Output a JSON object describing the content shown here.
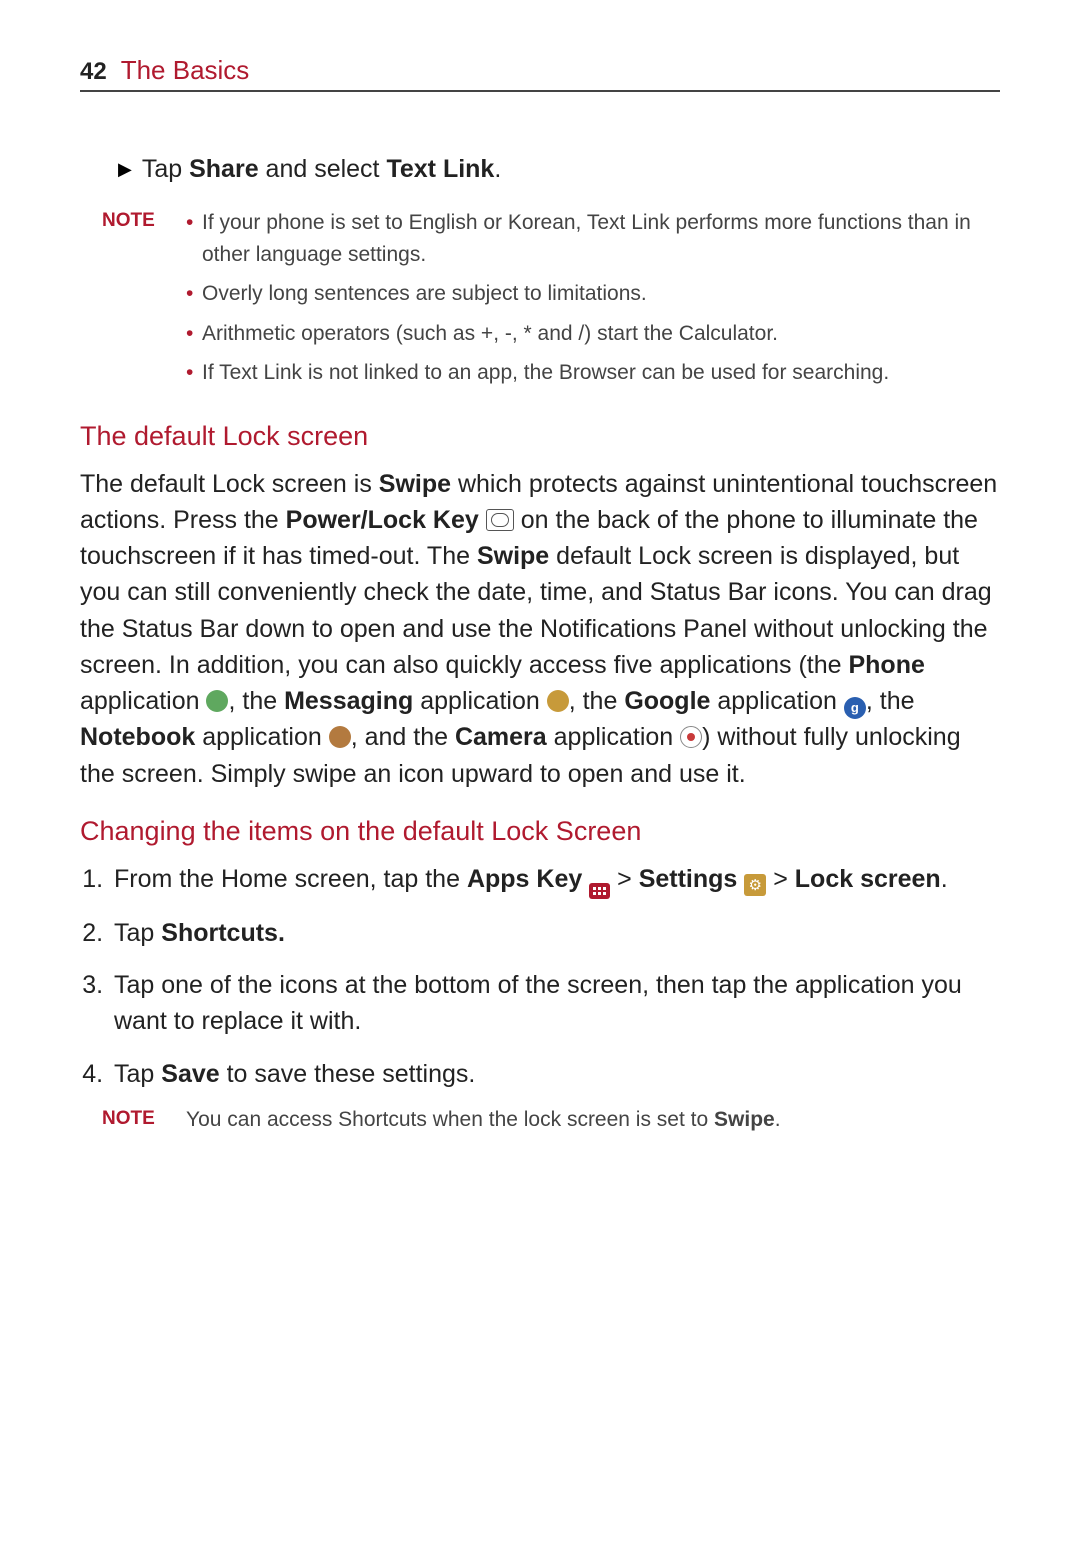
{
  "header": {
    "page_num": "42",
    "chapter": "The Basics"
  },
  "first_bullet": {
    "pre": "Tap ",
    "b1": "Share",
    "mid": " and select ",
    "b2": "Text Link",
    "post": "."
  },
  "note1": {
    "label": "NOTE",
    "items": [
      "If your phone is set to English or Korean, Text Link performs more functions than in other language settings.",
      "Overly long sentences are subject to limitations.",
      "Arithmetic operators (such as +, -, * and /) start the Calculator.",
      "If Text Link is not linked to an app, the Browser can be used for searching."
    ]
  },
  "section1": {
    "title": "The default Lock screen",
    "p_parts": {
      "t1": "The default Lock screen is ",
      "b1": "Swipe",
      "t2": " which protects against unintentional touchscreen actions. Press the ",
      "b2": "Power/Lock Key",
      "t3": " on the back of the phone to  illuminate the touchscreen if it has timed-out. The ",
      "b3": "Swipe",
      "t4": " default Lock screen is displayed, but you can still conveniently check the date, time, and Status Bar icons. You can drag the Status Bar down to open and use the Notifications Panel without unlocking the screen. In addition, you can also quickly access five applications (the ",
      "b4": "Phone",
      "t5": " application ",
      "t6": ", the ",
      "b5": "Messaging",
      "t7": " application ",
      "t8": ", the ",
      "b6": "Google",
      "t9": " application ",
      "t10": ", the ",
      "b7": "Notebook",
      "t11": " application ",
      "t12": ", and the ",
      "b8": "Camera",
      "t13": " application ",
      "t14": ") without fully unlocking the screen. Simply swipe an icon upward to open and use it."
    }
  },
  "section2": {
    "title": "Changing the items on the default Lock Screen",
    "step1": {
      "t1": "From the Home screen, tap the ",
      "b1": "Apps Key",
      "t2": " > ",
      "b2": "Settings",
      "t3": " > ",
      "b3": "Lock screen",
      "t4": "."
    },
    "step2": {
      "t1": "Tap ",
      "b1": "Shortcuts."
    },
    "step3": {
      "t1": "Tap one of the icons at the bottom of the screen, then tap the application you want to replace it with."
    },
    "step4": {
      "t1": "Tap ",
      "b1": "Save",
      "t2": " to save these settings."
    }
  },
  "note2": {
    "label": "NOTE",
    "t1": "You can access Shortcuts when the lock screen is set to ",
    "b1": "Swipe",
    "t2": "."
  },
  "icons": {
    "google_glyph": "g",
    "settings_glyph": "⚙"
  }
}
